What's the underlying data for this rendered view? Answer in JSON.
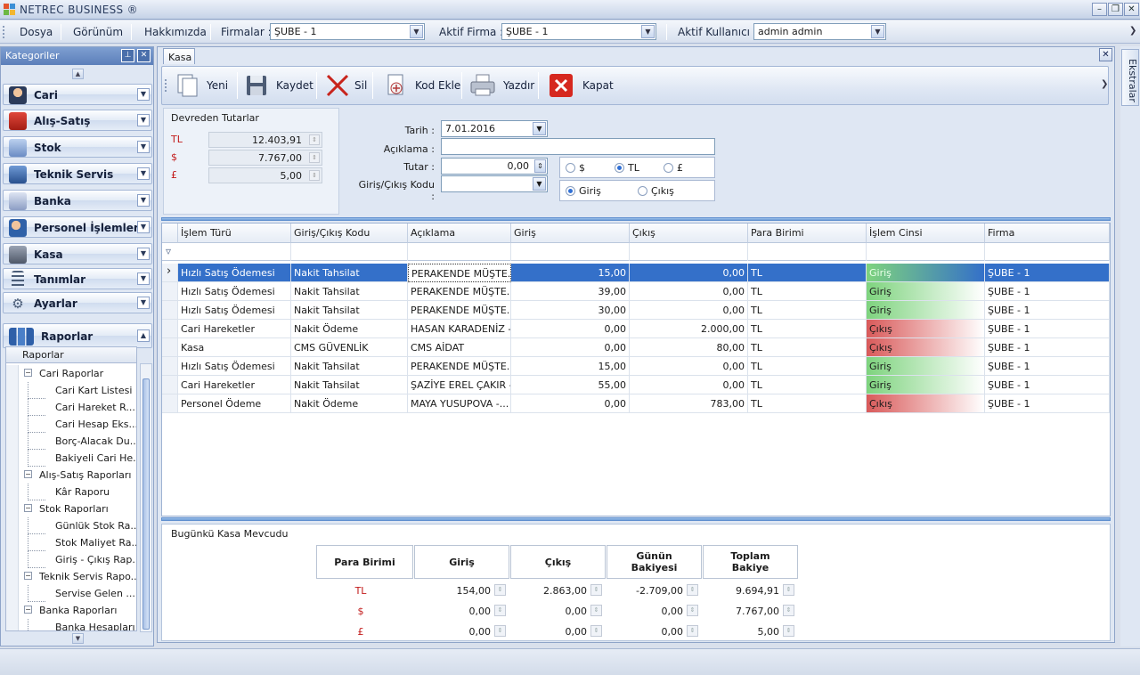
{
  "window": {
    "title": "NETREC BUSINESS ®"
  },
  "menu": {
    "items": [
      "Dosya",
      "Görünüm",
      "Hakkımızda"
    ],
    "firmalar_label": "Firmalar :",
    "firmalar_value": "ŞUBE - 1",
    "aktif_firma_label": "Aktif Firma :",
    "aktif_firma_value": "ŞUBE - 1",
    "aktif_kullanici_label": "Aktif Kullanıcı :",
    "aktif_kullanici_value": "admin admin"
  },
  "sidebar": {
    "header": "Kategoriler",
    "categories": [
      {
        "label": "Cari",
        "icon": "person-icon",
        "color": "#3a5a9a"
      },
      {
        "label": "Alış-Satış",
        "icon": "shopping-bag-icon",
        "color": "#c43a2a"
      },
      {
        "label": "Stok",
        "icon": "boxes-icon",
        "color": "#5a7db5"
      },
      {
        "label": "Teknik Servis",
        "icon": "computer-icon",
        "color": "#3f6ea8"
      },
      {
        "label": "Banka",
        "icon": "bank-icon",
        "color": "#6b7fae"
      },
      {
        "label": "Personel İşlemleri",
        "icon": "users-icon",
        "color": "#2f61a8"
      },
      {
        "label": "Kasa",
        "icon": "cash-box-icon",
        "color": "#6a7486"
      },
      {
        "label": "Tanımlar",
        "icon": "list-icon",
        "color": "#4b5d78"
      },
      {
        "label": "Ayarlar",
        "icon": "wrench-icon",
        "color": "#4b5d78"
      },
      {
        "label": "Raporlar",
        "icon": "report-chart-icon",
        "color": "#3c6cb2"
      }
    ],
    "tree_header": "Raporlar",
    "tree": [
      {
        "label": "Cari Raporlar",
        "level": 0
      },
      {
        "label": "Cari Kart Listesi",
        "level": 1
      },
      {
        "label": "Cari Hareket R...",
        "level": 1
      },
      {
        "label": "Cari Hesap Eks...",
        "level": 1
      },
      {
        "label": "Borç-Alacak Du...",
        "level": 1
      },
      {
        "label": "Bakiyeli Cari He...",
        "level": 1
      },
      {
        "label": "Alış-Satış Raporları",
        "level": 0
      },
      {
        "label": "Kâr Raporu",
        "level": 1
      },
      {
        "label": "Stok Raporları",
        "level": 0
      },
      {
        "label": "Günlük Stok Ra...",
        "level": 1
      },
      {
        "label": "Stok Maliyet Ra...",
        "level": 1
      },
      {
        "label": "Giriş - Çıkış Rap...",
        "level": 1
      },
      {
        "label": "Teknik Servis Rapo...",
        "level": 0
      },
      {
        "label": "Servise Gelen ...",
        "level": 1
      },
      {
        "label": "Banka Raporları",
        "level": 0
      },
      {
        "label": "Banka Hesapları",
        "level": 1
      }
    ]
  },
  "tab": {
    "label": "Kasa"
  },
  "toolbar": {
    "buttons": [
      {
        "label": "Yeni",
        "icon": "new-document-icon"
      },
      {
        "label": "Kaydet",
        "icon": "save-disk-icon"
      },
      {
        "label": "Sil",
        "icon": "delete-x-icon"
      },
      {
        "label": "Kod Ekle",
        "icon": "add-code-icon"
      },
      {
        "label": "Yazdır",
        "icon": "printer-icon"
      },
      {
        "label": "Kapat",
        "icon": "close-red-icon"
      }
    ]
  },
  "devreden": {
    "title": "Devreden Tutarlar",
    "rows": [
      {
        "currency": "TL",
        "value": "12.403,91"
      },
      {
        "currency": "$",
        "value": "7.767,00"
      },
      {
        "currency": "£",
        "value": "5,00"
      }
    ]
  },
  "form": {
    "tarih_label": "Tarih :",
    "tarih_value": "7.01.2016",
    "aciklama_label": "Açıklama :",
    "aciklama_value": "",
    "tutar_label": "Tutar :",
    "tutar_value": "0,00",
    "kod_label": "Giriş/Çıkış Kodu :",
    "kod_value": "",
    "currency_options": [
      {
        "label": "$",
        "selected": false
      },
      {
        "label": "TL",
        "selected": true
      },
      {
        "label": "£",
        "selected": false
      }
    ],
    "direction_options": [
      {
        "label": "Giriş",
        "selected": true
      },
      {
        "label": "Çıkış",
        "selected": false
      }
    ]
  },
  "grid": {
    "columns": [
      "İşlem Türü",
      "Giriş/Çıkış Kodu",
      "Açıklama",
      "Giriş",
      "Çıkış",
      "Para Birimi",
      "İşlem Cinsi",
      "Firma"
    ],
    "rows": [
      {
        "tur": "Hızlı Satış Ödemesi",
        "kod": "Nakit Tahsilat",
        "aciklama": "PERAKENDE MÜŞTE...",
        "giris": "15,00",
        "cikis": "0,00",
        "para": "TL",
        "cins": "Giriş",
        "firma": "ŞUBE - 1",
        "selected": true
      },
      {
        "tur": "Hızlı Satış Ödemesi",
        "kod": "Nakit Tahsilat",
        "aciklama": "PERAKENDE MÜŞTE...",
        "giris": "39,00",
        "cikis": "0,00",
        "para": "TL",
        "cins": "Giriş",
        "firma": "ŞUBE - 1"
      },
      {
        "tur": "Hızlı Satış Ödemesi",
        "kod": "Nakit Tahsilat",
        "aciklama": "PERAKENDE MÜŞTE...",
        "giris": "30,00",
        "cikis": "0,00",
        "para": "TL",
        "cins": "Giriş",
        "firma": "ŞUBE - 1"
      },
      {
        "tur": "Cari Hareketler",
        "kod": "Nakit Ödeme",
        "aciklama": "HASAN KARADENİZ -",
        "giris": "0,00",
        "cikis": "2.000,00",
        "para": "TL",
        "cins": "Çıkış",
        "firma": "ŞUBE - 1"
      },
      {
        "tur": "Kasa",
        "kod": "CMS GÜVENLİK",
        "aciklama": "CMS AİDAT",
        "giris": "0,00",
        "cikis": "80,00",
        "para": "TL",
        "cins": "Çıkış",
        "firma": "ŞUBE - 1"
      },
      {
        "tur": "Hızlı Satış Ödemesi",
        "kod": "Nakit Tahsilat",
        "aciklama": "PERAKENDE MÜŞTE...",
        "giris": "15,00",
        "cikis": "0,00",
        "para": "TL",
        "cins": "Giriş",
        "firma": "ŞUBE - 1"
      },
      {
        "tur": "Cari Hareketler",
        "kod": "Nakit Tahsilat",
        "aciklama": "ŞAZİYE EREL ÇAKIR -",
        "giris": "55,00",
        "cikis": "0,00",
        "para": "TL",
        "cins": "Giriş",
        "firma": "ŞUBE - 1"
      },
      {
        "tur": "Personel Ödeme",
        "kod": "Nakit Ödeme",
        "aciklama": "MAYA YUSUPOVA -...",
        "giris": "0,00",
        "cikis": "783,00",
        "para": "TL",
        "cins": "Çıkış",
        "firma": "ŞUBE - 1"
      }
    ],
    "colors": {
      "giris": "#7ed37e",
      "cikis": "#d95a5a",
      "selected": "#3470c9"
    }
  },
  "bugunku": {
    "title": "Bugünkü Kasa Mevcudu",
    "headers": [
      "Para Birimi",
      "Giriş",
      "Çıkış",
      "Günün Bakiyesi",
      "Toplam Bakiye"
    ],
    "rows": [
      {
        "currency": "TL",
        "giris": "154,00",
        "cikis": "2.863,00",
        "gunun": "-2.709,00",
        "toplam": "9.694,91"
      },
      {
        "currency": "$",
        "giris": "0,00",
        "cikis": "0,00",
        "gunun": "0,00",
        "toplam": "7.767,00"
      },
      {
        "currency": "£",
        "giris": "0,00",
        "cikis": "0,00",
        "gunun": "0,00",
        "toplam": "5,00"
      }
    ]
  },
  "rightbar": {
    "label": "Ekstralar"
  }
}
